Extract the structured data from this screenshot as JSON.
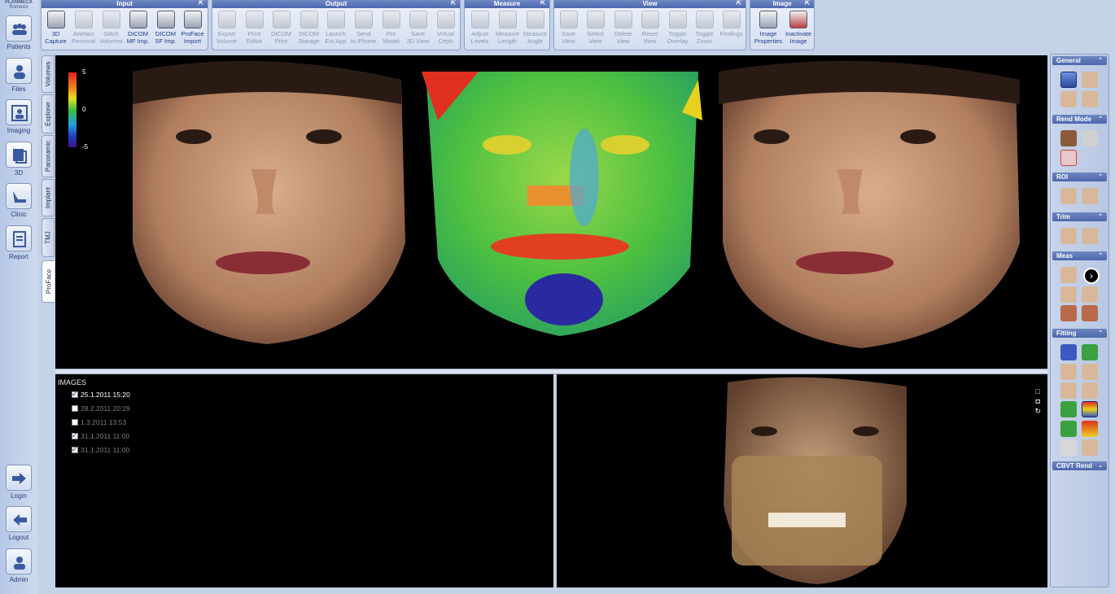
{
  "brand": {
    "name": "PLANMECA",
    "product": "Romexis"
  },
  "leftnav": [
    {
      "label": "Patients",
      "icon": "patients-icon"
    },
    {
      "label": "Files",
      "icon": "files-icon"
    },
    {
      "label": "Imaging",
      "icon": "imaging-icon"
    },
    {
      "label": "3D",
      "icon": "3d-icon"
    },
    {
      "label": "Clinic",
      "icon": "clinic-icon"
    },
    {
      "label": "Report",
      "icon": "report-icon"
    }
  ],
  "leftnav_bottom": [
    {
      "label": "Login",
      "icon": "login-icon"
    },
    {
      "label": "Logout",
      "icon": "logout-icon"
    },
    {
      "label": "Admin",
      "icon": "admin-icon"
    }
  ],
  "ribbon": {
    "input": {
      "title": "Input",
      "tools": [
        {
          "l1": "3D",
          "l2": "Capture"
        },
        {
          "l1": "Artefact",
          "l2": "Removal"
        },
        {
          "l1": "Stitch",
          "l2": "Volumes"
        },
        {
          "l1": "DICOM",
          "l2": "MF Imp."
        },
        {
          "l1": "DICOM",
          "l2": "SF Imp."
        },
        {
          "l1": "ProFace",
          "l2": "Import"
        }
      ]
    },
    "output": {
      "title": "Output",
      "tools": [
        {
          "l1": "Export",
          "l2": "Volume"
        },
        {
          "l1": "Print",
          "l2": "Editor"
        },
        {
          "l1": "DICOM",
          "l2": "Print"
        },
        {
          "l1": "DICOM",
          "l2": "Storage"
        },
        {
          "l1": "Launch",
          "l2": "Ext.App"
        },
        {
          "l1": "Send",
          "l2": "to iPhone"
        },
        {
          "l1": "Pro",
          "l2": "Model"
        },
        {
          "l1": "Save",
          "l2": "2D View"
        },
        {
          "l1": "Virtual",
          "l2": "Ceph"
        }
      ]
    },
    "measure": {
      "title": "Measure",
      "tools": [
        {
          "l1": "Adjust",
          "l2": "Levels"
        },
        {
          "l1": "Measure",
          "l2": "Length"
        },
        {
          "l1": "Measure",
          "l2": "Angle"
        }
      ]
    },
    "view": {
      "title": "View",
      "tools": [
        {
          "l1": "Save",
          "l2": "View"
        },
        {
          "l1": "Select",
          "l2": "View"
        },
        {
          "l1": "Delete",
          "l2": "View"
        },
        {
          "l1": "Reset",
          "l2": "View"
        },
        {
          "l1": "Toggle",
          "l2": "Overlay"
        },
        {
          "l1": "Toggle",
          "l2": "Zoom"
        },
        {
          "l1": "Findings",
          "l2": ""
        }
      ]
    },
    "image": {
      "title": "Image",
      "tools": [
        {
          "l1": "Image",
          "l2": "Properties"
        },
        {
          "l1": "Inactivate",
          "l2": "Image"
        }
      ]
    }
  },
  "vtabs": [
    "Volumes",
    "Explorer",
    "Panoramic",
    "Implant",
    "TMJ",
    "ProFace"
  ],
  "colorbar": {
    "max": "5",
    "mid": "0",
    "min": "-5"
  },
  "images": {
    "title": "IMAGES",
    "rows": [
      {
        "label": "25.1.2011 15:20",
        "checked": true,
        "selected": true
      },
      {
        "label": "28.2.2011 20:29",
        "checked": false,
        "selected": false
      },
      {
        "label": "1.3.2011 13:53",
        "checked": false,
        "selected": false
      },
      {
        "label": "31.1.2011 11:00",
        "checked": true,
        "selected": false
      },
      {
        "label": "31.1.2011 11:00",
        "checked": true,
        "selected": false
      }
    ]
  },
  "rightpanel": [
    {
      "title": "General",
      "caret": "up"
    },
    {
      "title": "Rend Mode",
      "caret": "up"
    },
    {
      "title": "ROI",
      "caret": "up"
    },
    {
      "title": "Trim",
      "caret": "up"
    },
    {
      "title": "Meas",
      "caret": "up"
    },
    {
      "title": "Fitting",
      "caret": "up"
    },
    {
      "title": "CBVT Rend",
      "caret": "down"
    }
  ]
}
